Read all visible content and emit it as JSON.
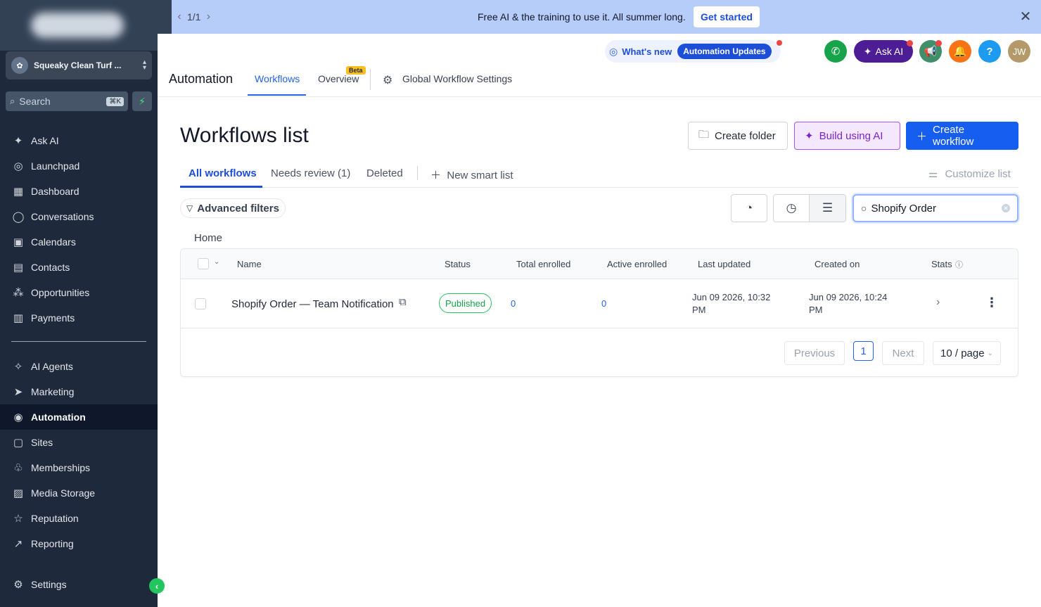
{
  "banner": {
    "counter": "1/1",
    "text": "Free AI & the training to use it. All summer long.",
    "cta": "Get started"
  },
  "sidebar": {
    "account_name": "Squeaky Clean Turf ...",
    "search_placeholder": "Search",
    "search_shortcut": "⌘K",
    "items": [
      {
        "label": "Ask AI",
        "icon": "sparkle-icon"
      },
      {
        "label": "Launchpad",
        "icon": "rocket-icon"
      },
      {
        "label": "Dashboard",
        "icon": "grid-icon"
      },
      {
        "label": "Conversations",
        "icon": "chat-icon"
      },
      {
        "label": "Calendars",
        "icon": "calendar-icon"
      },
      {
        "label": "Contacts",
        "icon": "contacts-icon"
      },
      {
        "label": "Opportunities",
        "icon": "network-icon"
      },
      {
        "label": "Payments",
        "icon": "receipt-icon"
      },
      {
        "label": "AI Agents",
        "icon": "sparkle-icon"
      },
      {
        "label": "Marketing",
        "icon": "send-icon"
      },
      {
        "label": "Automation",
        "icon": "automation-icon"
      },
      {
        "label": "Sites",
        "icon": "globe-icon"
      },
      {
        "label": "Memberships",
        "icon": "membership-icon"
      },
      {
        "label": "Media Storage",
        "icon": "image-icon"
      },
      {
        "label": "Reputation",
        "icon": "star-icon"
      },
      {
        "label": "Reporting",
        "icon": "trend-icon"
      },
      {
        "label": "Settings",
        "icon": "gear-icon"
      }
    ],
    "active": "Automation"
  },
  "header": {
    "whats_new": "What's new",
    "whats_new_pill": "Automation Updates",
    "ask_ai": "Ask AI",
    "avatar_initials": "JW",
    "help": "?",
    "title": "Automation",
    "tabs": [
      {
        "label": "Workflows",
        "active": true
      },
      {
        "label": "Overview",
        "badge": "Beta"
      },
      {
        "label": "Global Workflow Settings"
      }
    ]
  },
  "main": {
    "title": "Workflows list",
    "buttons": {
      "create_folder": "Create folder",
      "build_ai": "Build using AI",
      "create_workflow": "Create workflow"
    },
    "tabs": [
      {
        "label": "All workflows",
        "active": true
      },
      {
        "label": "Needs review (1)"
      },
      {
        "label": "Deleted"
      },
      {
        "label": "New smart list"
      }
    ],
    "customize": "Customize list",
    "advanced_filters": "Advanced filters",
    "search_value": "Shopify Order",
    "breadcrumb": "Home",
    "table": {
      "columns": [
        "Name",
        "Status",
        "Total enrolled",
        "Active enrolled",
        "Last updated",
        "Created on",
        "Stats"
      ],
      "rows": [
        {
          "name": "Shopify Order — Team Notification",
          "status": "Published",
          "total_enrolled": "0",
          "active_enrolled": "0",
          "last_updated_1": "Jun 09 2026, 10:32",
          "last_updated_2": "PM",
          "created_on_1": "Jun 09 2026, 10:24",
          "created_on_2": "PM"
        }
      ]
    },
    "pagination": {
      "previous": "Previous",
      "current": "1",
      "next": "Next",
      "page_size": "10 / page"
    }
  },
  "colors": {
    "sidebar_bg": "#1e293b",
    "banner_bg": "#b7cdf9",
    "primary": "#155eef",
    "ai_purple": "#7e22ce",
    "published_green": "#16a34a"
  }
}
